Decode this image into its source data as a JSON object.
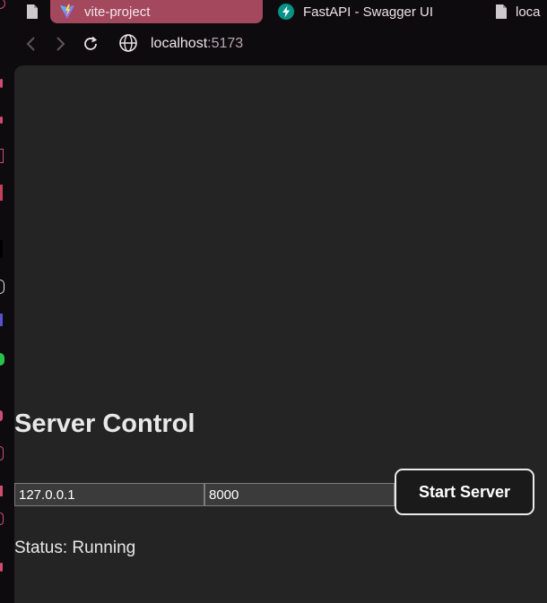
{
  "browser": {
    "tabs": [
      {
        "label": "vite-project",
        "active": true,
        "icon": "vite-icon"
      },
      {
        "label": "FastAPI - Swagger UI",
        "active": false,
        "icon": "fastapi-icon"
      },
      {
        "label": "loca",
        "active": false,
        "icon": "file-icon"
      }
    ],
    "url": {
      "host": "localhost",
      "port": ":5173"
    },
    "colors": {
      "active_tab": "#a4485e",
      "page_bg": "#242424",
      "chrome_bg": "#0e0b0e"
    }
  },
  "page": {
    "title": "Server Control",
    "host_value": "127.0.0.1",
    "port_value": "8000",
    "start_button": "Start Server",
    "status": "Status: Running"
  }
}
